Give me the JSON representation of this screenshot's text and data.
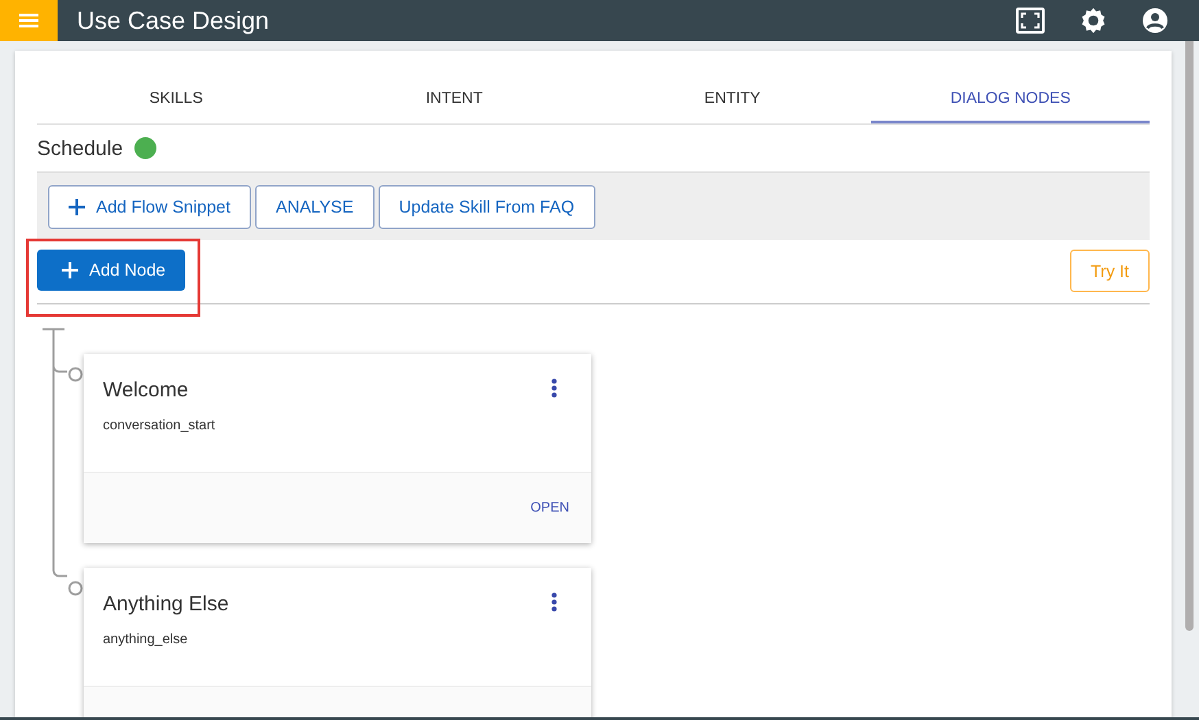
{
  "app_bar": {
    "title": "Use Case Design"
  },
  "tabs": [
    {
      "label": "SKILLS",
      "selected": false
    },
    {
      "label": "INTENT",
      "selected": false
    },
    {
      "label": "ENTITY",
      "selected": false
    },
    {
      "label": "DIALOG NODES",
      "selected": true
    }
  ],
  "skill": {
    "name": "Schedule",
    "color": "#4caf50"
  },
  "toolbar": [
    {
      "label": "Add Flow Snippet",
      "kind": "add"
    },
    {
      "label": "ANALYSE",
      "kind": "plain"
    },
    {
      "label": "Update Skill From FAQ",
      "kind": "plain"
    }
  ],
  "add_node_button": {
    "label": "Add Node"
  },
  "try_button": {
    "label": "Try It"
  },
  "nodes": [
    {
      "title": "Welcome",
      "condition": "conversation_start",
      "action": "OPEN"
    },
    {
      "title": "Anything Else",
      "condition": "anything_else"
    }
  ]
}
